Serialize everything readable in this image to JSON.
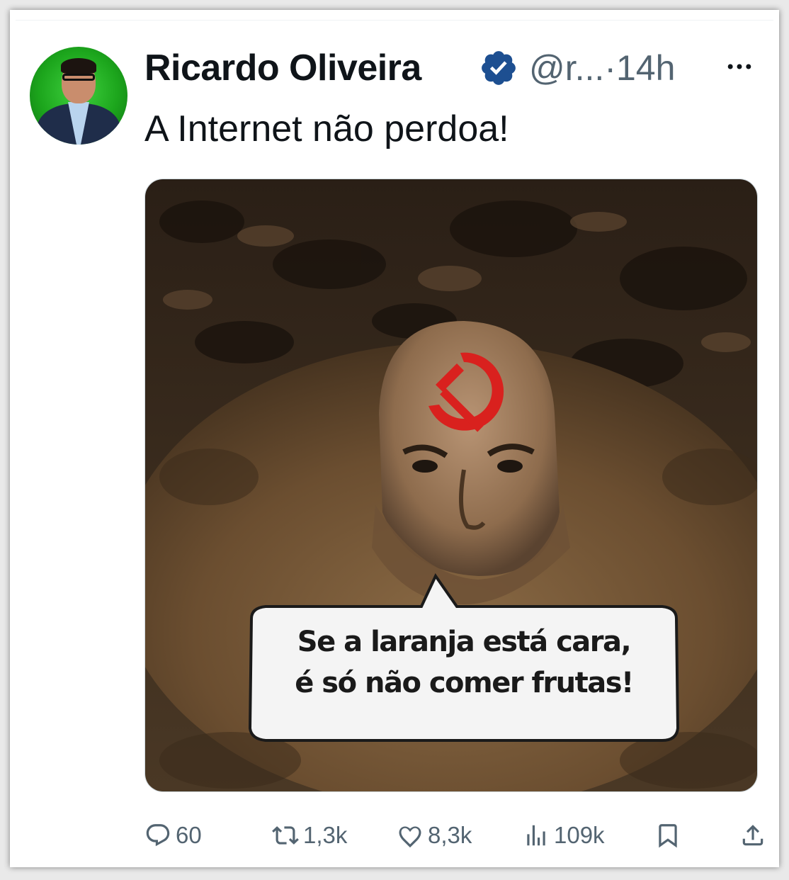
{
  "author": {
    "name": "Ricardo Oliveira",
    "handle": "@r...",
    "separator": "·",
    "time": "14h",
    "verified": true
  },
  "tweet": {
    "text": "A Internet não perdoa!"
  },
  "media": {
    "speech_bubble_line1": "Se a laranja está cara,",
    "speech_bubble_line2": "é só não comer frutas!"
  },
  "actions": {
    "replies": "60",
    "reposts": "1,3k",
    "likes": "8,3k",
    "views": "109k"
  },
  "colors": {
    "verified_badge": "#1d4f91",
    "text_primary": "#0f1419",
    "text_secondary": "#536471",
    "symbol_red": "#d9211e"
  },
  "icons": [
    "avatar",
    "verified-badge-icon",
    "more-icon",
    "reply-icon",
    "repost-icon",
    "like-icon",
    "views-icon",
    "bookmark-icon",
    "share-icon"
  ]
}
